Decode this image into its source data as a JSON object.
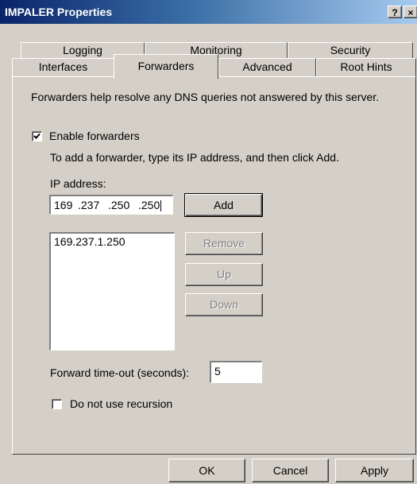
{
  "window": {
    "title": "IMPALER Properties",
    "help_label": "?",
    "close_label": "×"
  },
  "tabs": {
    "row1": [
      "Logging",
      "Monitoring",
      "Security"
    ],
    "row2": [
      "Interfaces",
      "Forwarders",
      "Advanced",
      "Root Hints"
    ],
    "active": "Forwarders"
  },
  "forwarders": {
    "description": "Forwarders help resolve any DNS queries not answered by this server.",
    "enable_label": "Enable forwarders",
    "enable_checked": true,
    "instruction": "To add a forwarder, type its IP address, and then click Add.",
    "ip_label": "IP address:",
    "ip_octets": [
      "169",
      ".237",
      ".250",
      ".250"
    ],
    "add_label": "Add",
    "list": [
      "169.237.1.250"
    ],
    "remove_label": "Remove",
    "up_label": "Up",
    "down_label": "Down",
    "timeout_label": "Forward time-out (seconds):",
    "timeout_value": "5",
    "recursion_label": "Do not use recursion",
    "recursion_checked": false
  },
  "buttons": {
    "ok": "OK",
    "cancel": "Cancel",
    "apply": "Apply"
  },
  "colors": {
    "face": "#d4d0c8",
    "title_start": "#0a246a",
    "title_end": "#a6caf0"
  }
}
